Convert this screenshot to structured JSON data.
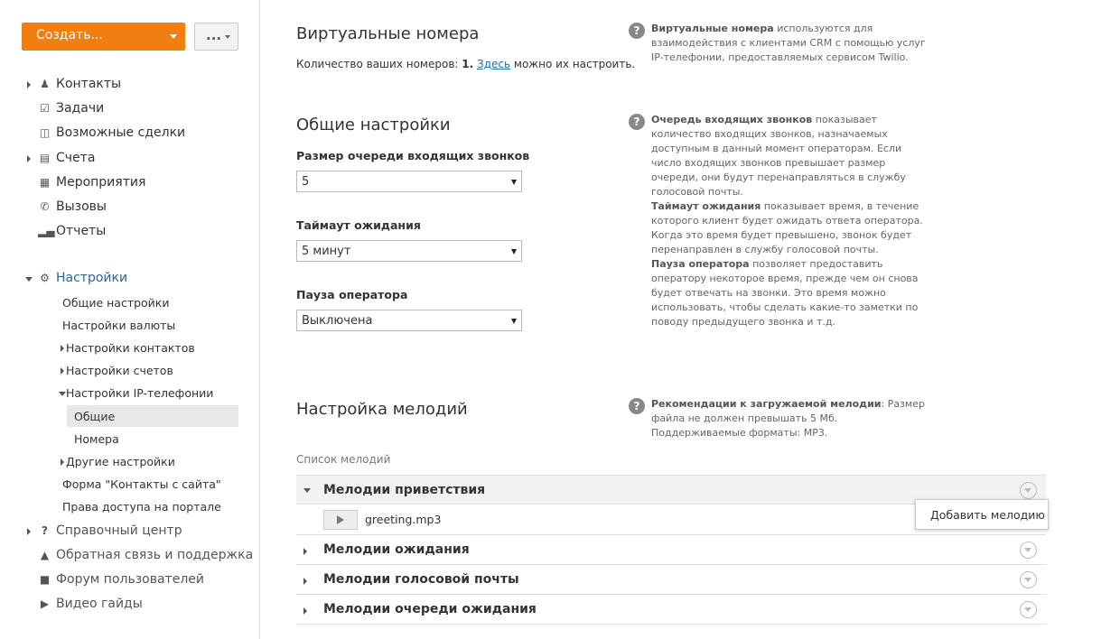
{
  "sidebar": {
    "create_label": "Создать...",
    "more_label": "...",
    "items": [
      {
        "label": "Контакты",
        "icon": "people-icon"
      },
      {
        "label": "Задачи",
        "icon": "checkbox-icon"
      },
      {
        "label": "Возможные сделки",
        "icon": "briefcase-icon"
      },
      {
        "label": "Счета",
        "icon": "document-icon"
      },
      {
        "label": "Мероприятия",
        "icon": "calendar-icon"
      },
      {
        "label": "Вызовы",
        "icon": "phone-icon"
      },
      {
        "label": "Отчеты",
        "icon": "bar-chart-icon"
      }
    ],
    "settings_label": "Настройки",
    "settings_sub": [
      "Общие настройки",
      "Настройки валюты",
      "Настройки контактов",
      "Настройки счетов",
      "Настройки IP-телефонии",
      "Общие",
      "Номера",
      "Другие настройки",
      "Форма \"Контакты с сайта\"",
      "Права доступа на портале"
    ],
    "bottom": [
      {
        "label": "Справочный центр",
        "icon": "question-icon"
      },
      {
        "label": "Обратная связь и поддержка",
        "icon": "megaphone-icon"
      },
      {
        "label": "Форум пользователей",
        "icon": "chat-icon"
      },
      {
        "label": "Видео гайды",
        "icon": "video-icon"
      }
    ]
  },
  "virtual": {
    "title": "Виртуальные номера",
    "count_prefix": "Количество ваших номеров:",
    "count": "1.",
    "link": "Здесь",
    "suffix": "можно их настроить.",
    "help_bold": "Виртуальные номера",
    "help_text": "используются для взаимодействия с клиентами CRM с помощью услуг IP-телефонии, предоставляемых сервисом Twilio."
  },
  "general": {
    "title": "Общие настройки",
    "queue_label": "Размер очереди входящих звонков",
    "queue_value": "5",
    "timeout_label": "Таймаут ожидания",
    "timeout_value": "5 минут",
    "pause_label": "Пауза оператора",
    "pause_value": "Выключена",
    "help1_bold": "Очередь входящих звонков",
    "help1_text": "показывает количество входящих звонков, назначаемых доступным в данный момент операторам. Если число входящих звонков превышает размер очереди, они будут перенаправляться в службу голосовой почты.",
    "help2_bold": "Таймаут ожидания",
    "help2_text": "показывает время, в течение которого клиент будет ожидать ответа оператора. Когда это время будет превышено, звонок будет перенаправлен в службу голосовой почты.",
    "help3_bold": "Пауза оператора",
    "help3_text": "позволяет предоставить оператору некоторое время, прежде чем он снова будет отвечать на звонки. Это время можно использовать, чтобы сделать какие-то заметки по поводу предыдущего звонка и т.д."
  },
  "melodies": {
    "title": "Настройка мелодий",
    "help_bold": "Рекомендации к загружаемой мелодии",
    "help_text": ": Размер файла не должен превышать 5 Мб. Поддерживаемые форматы: MP3.",
    "list_caption": "Список мелодий",
    "groups": [
      "Мелодии приветствия",
      "Мелодии ожидания",
      "Мелодии голосовой почты",
      "Мелодии очереди ожидания"
    ],
    "file": "greeting.mp3",
    "popup": "Добавить мелодию"
  },
  "colors": {
    "accent": "#f07e10",
    "link": "#1d6faa"
  }
}
